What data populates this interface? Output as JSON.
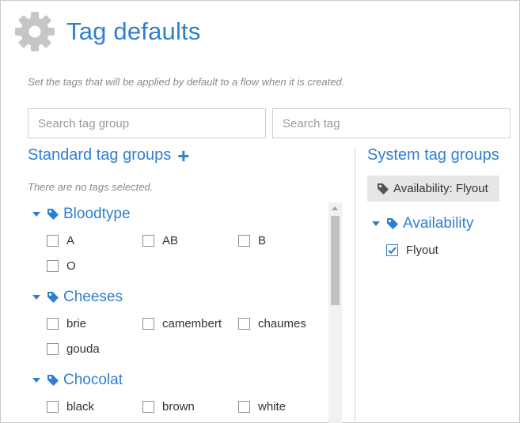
{
  "header": {
    "title": "Tag defaults",
    "icon": "gear-icon"
  },
  "description": "Set the tags that will be applied by default to a flow when it is created.",
  "search": {
    "group_placeholder": "Search tag group",
    "tag_placeholder": "Search tag"
  },
  "standard": {
    "title": "Standard tag groups",
    "add_label": "+",
    "empty_text": "There are no tags selected.",
    "groups": [
      {
        "name": "Bloodtype",
        "options": [
          "A",
          "AB",
          "B",
          "O"
        ]
      },
      {
        "name": "Cheeses",
        "options": [
          "brie",
          "camembert",
          "chaumes",
          "gouda"
        ]
      },
      {
        "name": "Chocolat",
        "options": [
          "black",
          "brown",
          "white"
        ]
      }
    ]
  },
  "system": {
    "title": "System tag groups",
    "selected_chip": "Availability: Flyout",
    "groups": [
      {
        "name": "Availability",
        "options": [
          {
            "label": "Flyout",
            "checked": true
          }
        ]
      }
    ]
  },
  "colors": {
    "accent": "#2f7fd1",
    "chip_bg": "#e6e6e6",
    "muted": "#8a8a8a"
  }
}
